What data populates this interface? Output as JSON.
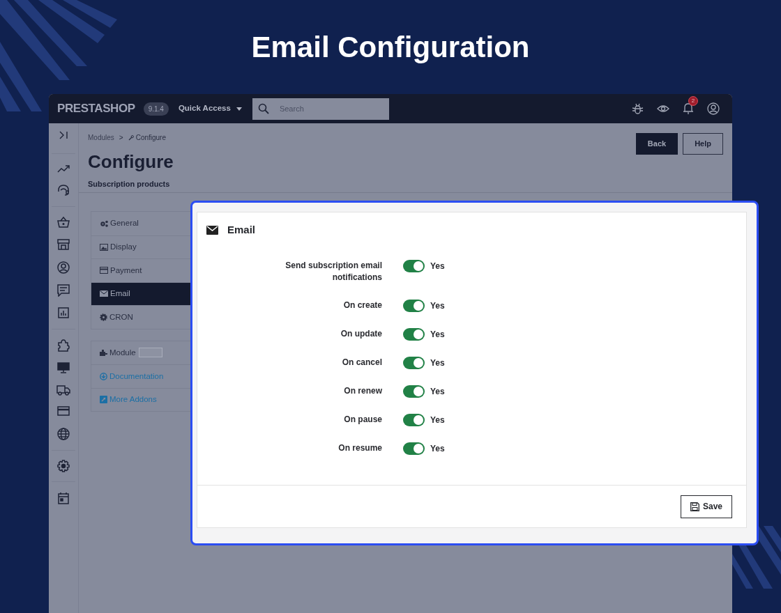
{
  "page_title": "Email Configuration",
  "topbar": {
    "logo": "PRESTASHOP",
    "version": "9.1.4",
    "quick_access": "Quick Access",
    "search": {
      "placeholder": "Search"
    },
    "notification_count": "2"
  },
  "breadcrumb": {
    "items": [
      "Modules",
      "Configure"
    ],
    "separator": ">"
  },
  "header": {
    "title": "Configure",
    "subtitle": "Subscription products",
    "buttons": [
      {
        "label": "Back",
        "kind": "primary"
      },
      {
        "label": "Help",
        "kind": "outline"
      }
    ]
  },
  "menu": [
    {
      "label": "General",
      "selected": false
    },
    {
      "label": "Display",
      "selected": false
    },
    {
      "label": "Payment",
      "selected": false
    },
    {
      "label": "Email",
      "selected": true
    },
    {
      "label": "CRON",
      "selected": false
    }
  ],
  "links": [
    {
      "label": "Module",
      "kind": "text"
    },
    {
      "label": "Documentation",
      "kind": "link"
    },
    {
      "label": "More Addons",
      "kind": "link"
    }
  ],
  "panel": {
    "title": "Email",
    "fields": [
      {
        "label": "Send subscription email notifications",
        "on": true,
        "value_label": "Yes"
      },
      {
        "label": "On create",
        "on": true,
        "value_label": "Yes"
      },
      {
        "label": "On update",
        "on": true,
        "value_label": "Yes"
      },
      {
        "label": "On cancel",
        "on": true,
        "value_label": "Yes"
      },
      {
        "label": "On renew",
        "on": true,
        "value_label": "Yes"
      },
      {
        "label": "On pause",
        "on": true,
        "value_label": "Yes"
      },
      {
        "label": "On resume",
        "on": true,
        "value_label": "Yes"
      }
    ],
    "save": "Save"
  }
}
